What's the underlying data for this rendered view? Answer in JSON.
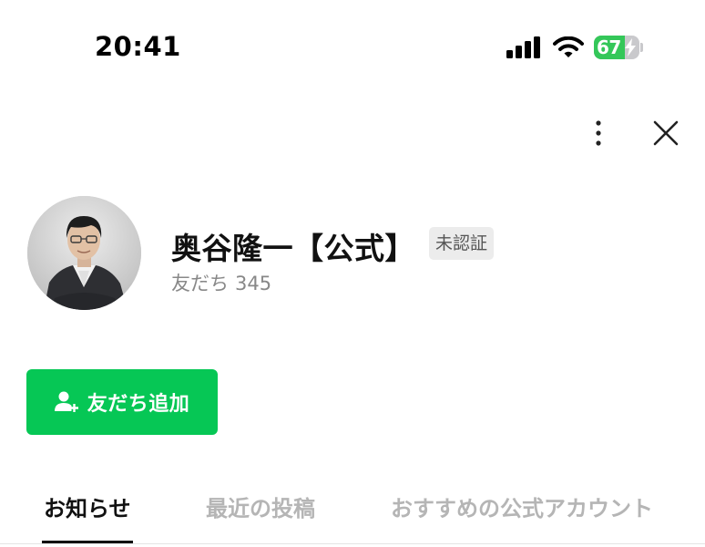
{
  "status_bar": {
    "time": "20:41",
    "battery_text": "67",
    "battery_level_percent": 67,
    "signal_icon": "cellular-signal-icon",
    "wifi_icon": "wifi-icon",
    "battery_icon": "battery-charging-icon"
  },
  "header": {
    "more_icon": "vertical-ellipsis-icon",
    "close_icon": "close-icon"
  },
  "profile": {
    "name": "奥谷隆一【公式】",
    "badge": "未認証",
    "friends_label": "友だち",
    "friends_count": "345"
  },
  "add_friend_button": {
    "label": "友だち追加",
    "icon": "add-person-icon"
  },
  "tabs": [
    {
      "label": "お知らせ",
      "active": true
    },
    {
      "label": "最近の投稿",
      "active": false
    },
    {
      "label": "おすすめの公式アカウント",
      "active": false
    }
  ],
  "colors": {
    "brand_green": "#06c755",
    "battery_green": "#34c759",
    "inactive_tab": "#b5b5b5",
    "badge_bg": "#ececec"
  }
}
